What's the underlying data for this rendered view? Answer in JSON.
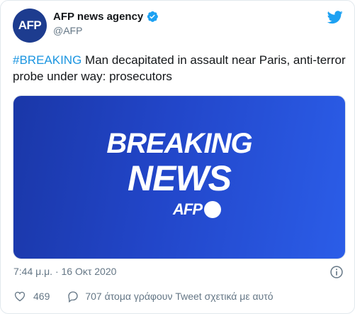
{
  "author": {
    "display_name": "AFP news agency",
    "handle": "@AFP",
    "avatar_text": "AFP"
  },
  "tweet": {
    "hashtag": "#BREAKING",
    "text": " Man decapitated in assault near Paris, anti-terror probe under way: prosecutors"
  },
  "media": {
    "line1": "BREAKING",
    "line2": "NEWS",
    "logo_text": "AFP",
    "colors": {
      "gradient_start": "#1a37a8",
      "gradient_end": "#2b5de8"
    }
  },
  "timestamp": "7:44 μ.μ. · 16 Οκτ 2020",
  "actions": {
    "likes": "469",
    "talking": "707 άτομα γράφουν Tweet σχετικά με αυτό"
  },
  "icons": {
    "verified": "verified-badge-icon",
    "bird": "twitter-bird-icon",
    "info": "info-icon",
    "like": "heart-icon",
    "reply": "reply-bubble-icon"
  },
  "colors": {
    "accent": "#1da1f2",
    "link": "#1b95e0",
    "muted": "#657786"
  }
}
